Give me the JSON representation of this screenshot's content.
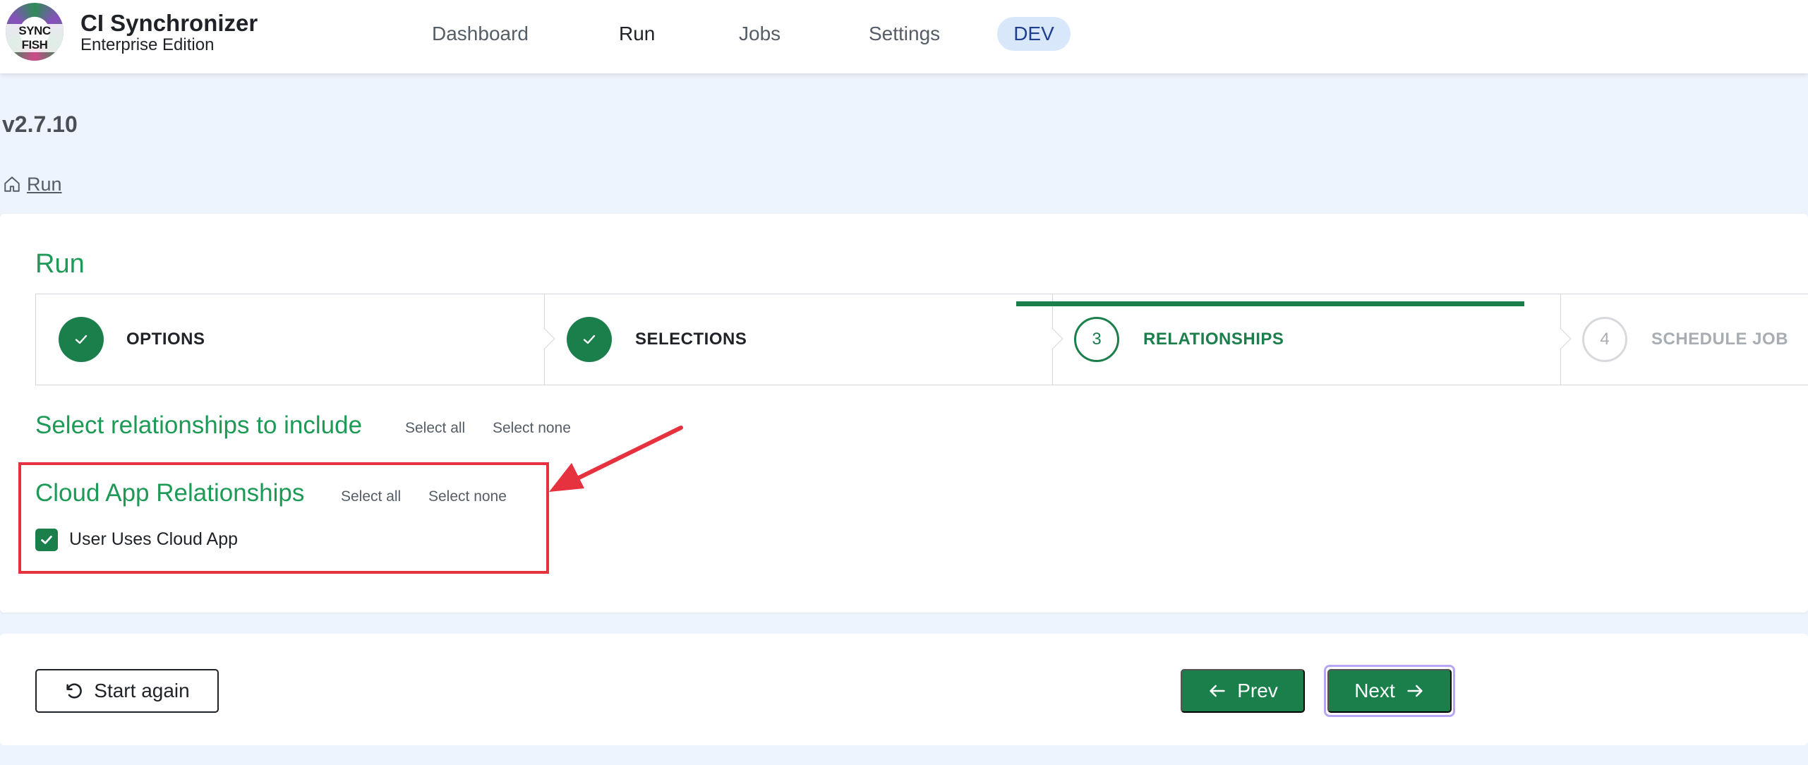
{
  "app": {
    "logo_text": "SYNC FISH",
    "title": "CI Synchronizer",
    "subtitle": "Enterprise Edition"
  },
  "nav": {
    "items": [
      {
        "label": "Dashboard",
        "active": false
      },
      {
        "label": "Run",
        "active": true
      },
      {
        "label": "Jobs",
        "active": false
      },
      {
        "label": "Settings",
        "active": false
      }
    ],
    "env_badge": "DEV"
  },
  "version": "v2.7.10",
  "breadcrumb": {
    "icon": "home-icon",
    "items": [
      "Run"
    ]
  },
  "page": {
    "title": "Run",
    "steps": [
      {
        "number": "1",
        "label": "OPTIONS",
        "state": "done"
      },
      {
        "number": "2",
        "label": "SELECTIONS",
        "state": "done"
      },
      {
        "number": "3",
        "label": "RELATIONSHIPS",
        "state": "current"
      },
      {
        "number": "4",
        "label": "SCHEDULE JOB",
        "state": "future"
      }
    ],
    "section_title": "Select relationships to include",
    "select_all": "Select all",
    "select_none": "Select none",
    "group": {
      "title": "Cloud App Relationships",
      "select_all": "Select all",
      "select_none": "Select none",
      "items": [
        {
          "label": "User Uses Cloud App",
          "checked": true
        }
      ]
    }
  },
  "footer": {
    "start_again": "Start again",
    "prev": "Prev",
    "next": "Next"
  },
  "colors": {
    "accent": "#1a7f4b",
    "title_green": "#1e9a57",
    "annotation_red": "#e6323e",
    "background": "#eef4fd"
  }
}
